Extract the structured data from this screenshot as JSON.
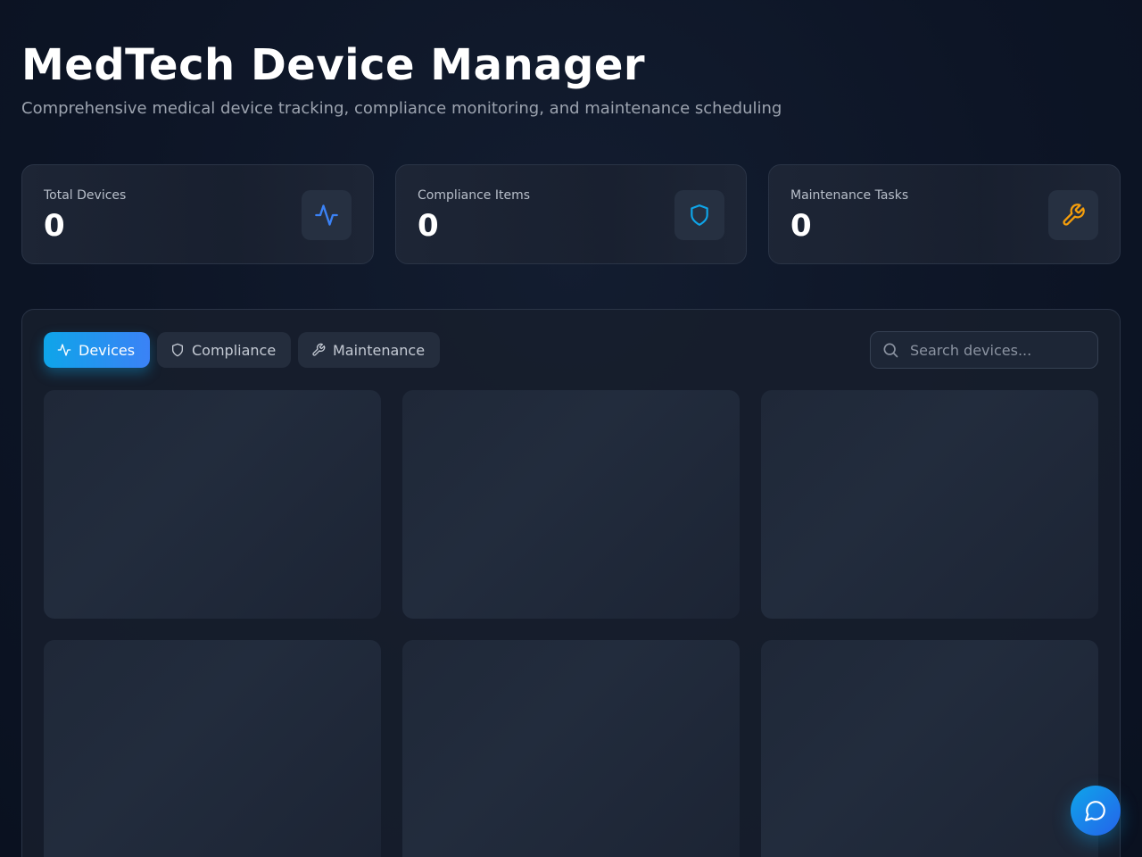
{
  "header": {
    "title": "MedTech Device Manager",
    "subtitle": "Comprehensive medical device tracking, compliance monitoring, and maintenance scheduling"
  },
  "stats": [
    {
      "label": "Total Devices",
      "value": "0",
      "icon": "activity-icon",
      "color": "#3b82f6"
    },
    {
      "label": "Compliance Items",
      "value": "0",
      "icon": "shield-icon",
      "color": "#0ea5e9"
    },
    {
      "label": "Maintenance Tasks",
      "value": "0",
      "icon": "wrench-icon",
      "color": "#f59e0b"
    }
  ],
  "tabs": [
    {
      "label": "Devices",
      "icon": "activity-icon",
      "active": true
    },
    {
      "label": "Compliance",
      "icon": "shield-icon",
      "active": false
    },
    {
      "label": "Maintenance",
      "icon": "wrench-icon",
      "active": false
    }
  ],
  "search": {
    "placeholder": "Search devices...",
    "value": ""
  },
  "colors": {
    "accent_start": "#0ea5e9",
    "accent_end": "#3b82f6",
    "background": "#0d1526",
    "card": "#1e2636"
  },
  "chat_button": {
    "icon": "chat-bubble-icon"
  }
}
